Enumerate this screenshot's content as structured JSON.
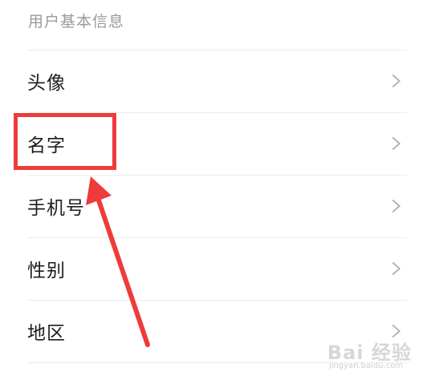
{
  "section": {
    "title": "用户基本信息"
  },
  "rows": [
    {
      "label": "头像",
      "chevron_icon": "chevron-right-icon"
    },
    {
      "label": "名字",
      "chevron_icon": "chevron-right-icon"
    },
    {
      "label": "手机号",
      "chevron_icon": "chevron-right-icon"
    },
    {
      "label": "性别",
      "chevron_icon": "chevron-right-icon"
    },
    {
      "label": "地区",
      "chevron_icon": "chevron-right-icon"
    }
  ],
  "annotation": {
    "color": "#ef3b3b",
    "highlight": "名字"
  },
  "watermark": {
    "brand": "Bai 经验",
    "url": "jingyan.baidu.com"
  }
}
